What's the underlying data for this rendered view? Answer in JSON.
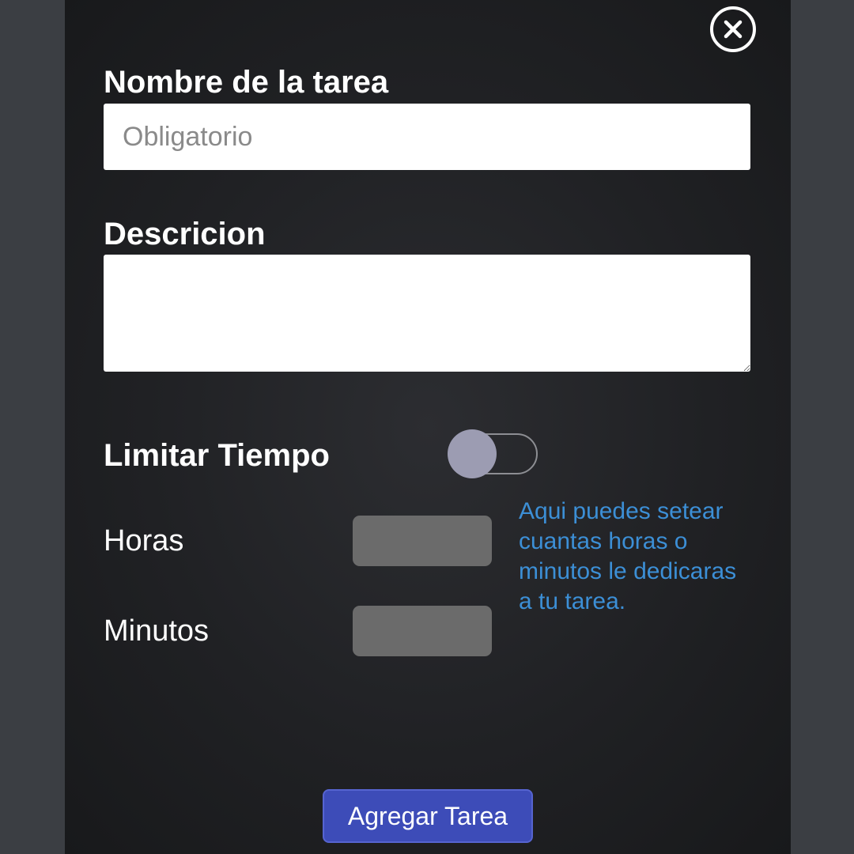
{
  "form": {
    "task_name_label": "Nombre de la tarea",
    "task_name_placeholder": "Obligatorio",
    "description_label": "Descricion",
    "limit_time_label": "Limitar Tiempo",
    "hours_label": "Horas",
    "minutes_label": "Minutos",
    "hint_text": "Aqui puedes setear cuantas horas o minutos le dedicaras a tu tarea.",
    "submit_label": "Agregar Tarea"
  },
  "icons": {
    "close": "close-icon"
  },
  "colors": {
    "page_background": "#3b3e43",
    "modal_background": "#202124",
    "hint_text": "#3c8fd6",
    "submit_button": "#3d4cb8",
    "toggle_knob": "#9c9cb2",
    "number_input": "#6b6b6b"
  },
  "toggle": {
    "limit_time_enabled": false
  }
}
